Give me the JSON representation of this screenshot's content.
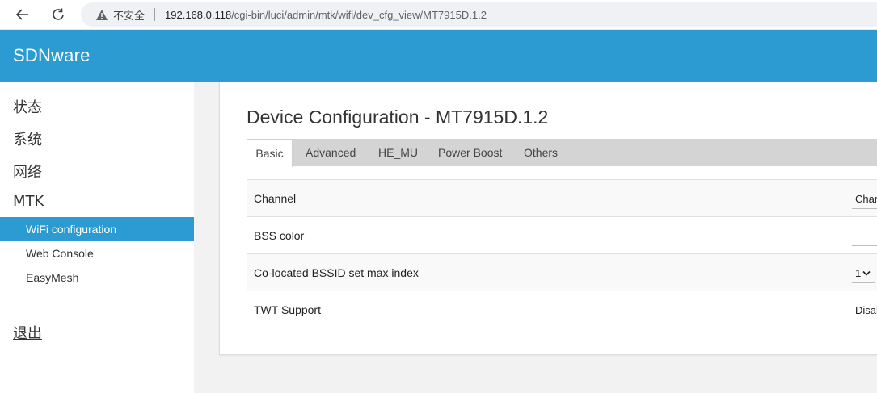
{
  "browser": {
    "insecure_label": "不安全",
    "url_host": "192.168.0.118",
    "url_path": "/cgi-bin/luci/admin/mtk/wifi/dev_cfg_view/MT7915D.1.2"
  },
  "header": {
    "brand": "SDNware"
  },
  "sidebar": {
    "items": [
      {
        "label": "状态"
      },
      {
        "label": "系统"
      },
      {
        "label": "网络"
      },
      {
        "label": "MTK"
      }
    ],
    "subitems": [
      {
        "label": "WiFi configuration",
        "active": true
      },
      {
        "label": "Web Console"
      },
      {
        "label": "EasyMesh"
      }
    ],
    "logout": "退出"
  },
  "main": {
    "title": "Device Configuration - MT7915D.1.2",
    "tabs": [
      {
        "label": "Basic",
        "active": true
      },
      {
        "label": "Advanced"
      },
      {
        "label": "HE_MU"
      },
      {
        "label": "Power Boost"
      },
      {
        "label": "Others"
      }
    ],
    "rows": [
      {
        "label": "Channel",
        "value": "Chan"
      },
      {
        "label": "BSS color",
        "value": ""
      },
      {
        "label": "Co-located BSSID set max index",
        "value": "1"
      },
      {
        "label": "TWT Support",
        "value": "Disab"
      }
    ]
  },
  "colors": {
    "accent": "#2b9bd1"
  }
}
